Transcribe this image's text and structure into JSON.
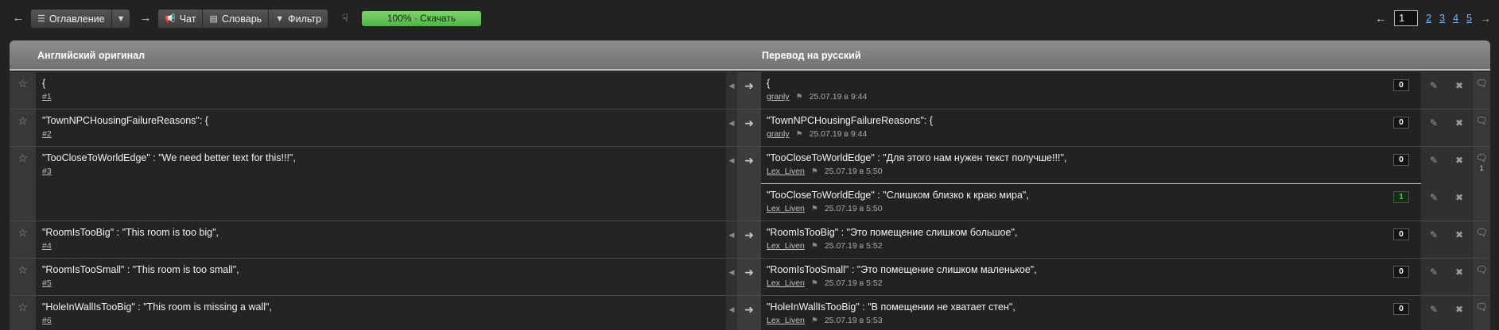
{
  "toolbar": {
    "toc_label": "Оглавление",
    "chat_label": "Чат",
    "dict_label": "Словарь",
    "filter_label": "Фильтр",
    "progress_label": "100% · Скачать",
    "progress_fraction": 1.0
  },
  "pager": {
    "current": "1",
    "pages": [
      "2",
      "3",
      "4",
      "5"
    ]
  },
  "table": {
    "col_original": "Английский оригинал",
    "col_translation": "Перевод на русский"
  },
  "rows": [
    {
      "source": "{",
      "num": "#1",
      "translations": [
        {
          "text": "{",
          "user": "granly",
          "date": "25.07.19 в 9:44",
          "votes": "0"
        }
      ]
    },
    {
      "source": "\"TownNPCHousingFailureReasons\": {",
      "num": "#2",
      "translations": [
        {
          "text": "\"TownNPCHousingFailureReasons\": {",
          "user": "granly",
          "date": "25.07.19 в 9:44",
          "votes": "0"
        }
      ]
    },
    {
      "source": "\"TooCloseToWorldEdge\" : \"We need better text for this!!!\",",
      "num": "#3",
      "comments": "1",
      "translations": [
        {
          "text": "\"TooCloseToWorldEdge\" : \"Для этого нам нужен текст получше!!!\",",
          "user": "Lex_Liven",
          "date": "25.07.19 в 5:50",
          "votes": "0"
        },
        {
          "text": "\"TooCloseToWorldEdge\" : \"Слишком близко к краю мира\",",
          "user": "Lex_Liven",
          "date": "25.07.19 в 5:50",
          "votes": "1"
        }
      ]
    },
    {
      "source": "\"RoomIsTooBig\" : \"This room is too big\",",
      "num": "#4",
      "translations": [
        {
          "text": "\"RoomIsTooBig\" : \"Это помещение слишком большое\",",
          "user": "Lex_Liven",
          "date": "25.07.19 в 5:52",
          "votes": "0"
        }
      ]
    },
    {
      "source": "\"RoomIsTooSmall\" : \"This room is too small\",",
      "num": "#5",
      "translations": [
        {
          "text": "\"RoomIsTooSmall\" : \"Это помещение слишком маленькое\",",
          "user": "Lex_Liven",
          "date": "25.07.19 в 5:52",
          "votes": "0"
        }
      ]
    },
    {
      "source": "\"HoleInWallIsTooBig\" : \"This room is missing a wall\",",
      "num": "#6",
      "translations": [
        {
          "text": "\"HoleInWallIsTooBig\" : \"В помещении не хватает стен\",",
          "user": "Lex_Liven",
          "date": "25.07.19 в 5:53",
          "votes": "0"
        }
      ]
    }
  ]
}
